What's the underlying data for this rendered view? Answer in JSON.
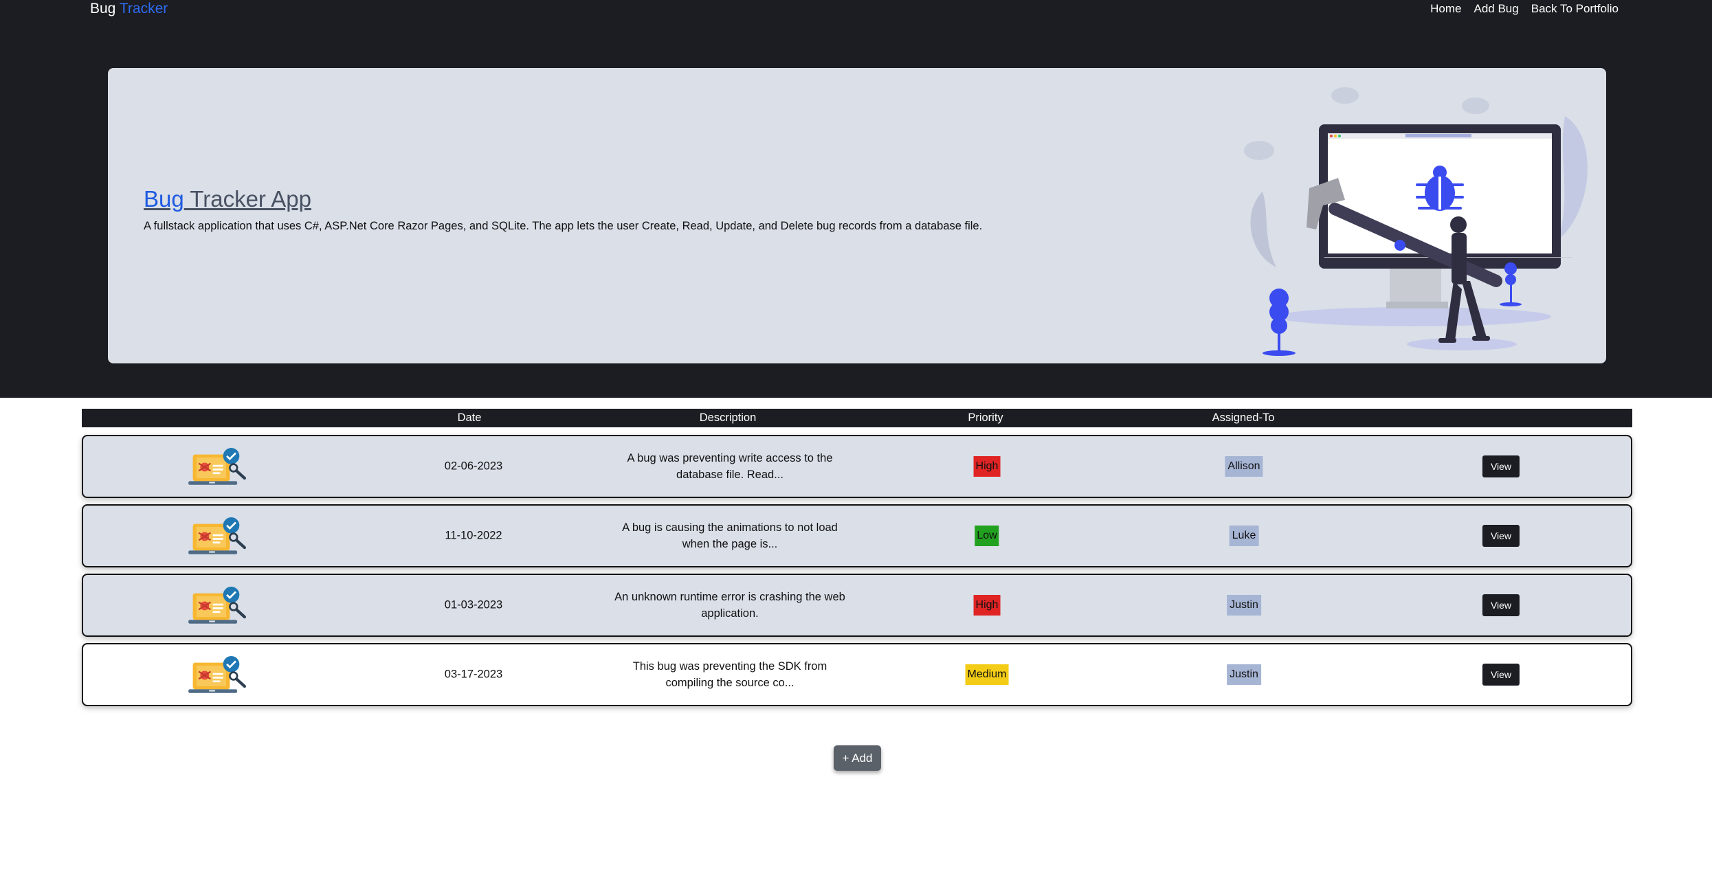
{
  "navbar": {
    "brand_part1": "Bug",
    "brand_part2": "Tracker",
    "links": [
      "Home",
      "Add Bug",
      "Back To Portfolio"
    ]
  },
  "hero": {
    "title_part1": "Bug",
    "title_part2": " Tracker App",
    "description": "A fullstack application that uses C#, ASP.Net Core Razor Pages, and SQLite. The app lets the user Create, Read, Update, and Delete bug records from a database file.",
    "illustration": "person-hammering-bug-on-monitor"
  },
  "table": {
    "headers": [
      "Date",
      "Description",
      "Priority",
      "Assigned-To"
    ],
    "rows": [
      {
        "date": "02-06-2023",
        "description": "A bug was preventing write access to the database file. Read...",
        "priority": "High",
        "priority_color": "#e02424",
        "assigned_to": "Allison",
        "action": "View",
        "icon": "bug-report-laptop-icon"
      },
      {
        "date": "11-10-2022",
        "description": "A bug is causing the animations to not load when the page is...",
        "priority": "Low",
        "priority_color": "#22a11f",
        "assigned_to": "Luke",
        "action": "View",
        "icon": "bug-report-laptop-icon"
      },
      {
        "date": "01-03-2023",
        "description": "An unknown runtime error is crashing the web application.",
        "priority": "High",
        "priority_color": "#e02424",
        "assigned_to": "Justin",
        "action": "View",
        "icon": "bug-report-laptop-icon"
      },
      {
        "date": "03-17-2023",
        "description": "This bug was preventing the SDK from compiling the source co...",
        "priority": "Medium",
        "priority_color": "#f3cc17",
        "assigned_to": "Justin",
        "action": "View",
        "icon": "bug-report-laptop-icon"
      }
    ]
  },
  "add_button": "+ Add",
  "colors": {
    "dark": "#1c1d22",
    "hero_bg": "#dadfe8",
    "accent": "#2f6bf0",
    "assignee_bg": "#a6b5d4"
  }
}
